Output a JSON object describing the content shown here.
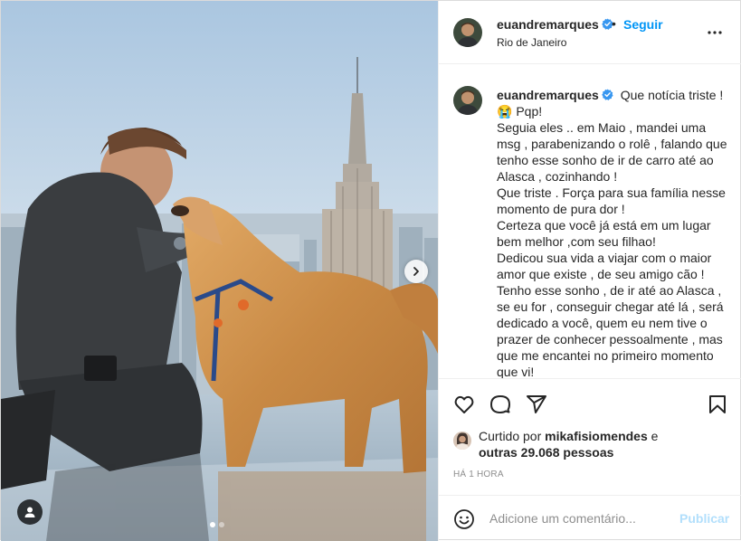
{
  "post": {
    "username": "euandremarques",
    "follow_label": "Seguir",
    "bullet": "•",
    "location": "Rio de Janeiro"
  },
  "caption": {
    "username": "euandremarques",
    "lines": [
      "Que notícia triste !",
      "😭 Pqp!",
      "Seguia eles .. em Maio , mandei uma msg , parabenizando o rolê , falando que tenho esse sonho de ir de carro até ao Alasca , cozinhando !",
      "Que triste . Força para sua família nesse momento de pura dor !",
      "Certeza que você já está em um lugar bem melhor ,com seu filhao!",
      "Dedicou sua vida a viajar com o maior amor que existe , de seu amigo cão !",
      "Tenho esse sonho , de ir até ao Alasca , se eu for , conseguir chegar até lá , será dedicado a você, quem eu nem tive o prazer de conhecer pessoalmente , mas que me encantei no primeiro momento que vi!"
    ]
  },
  "likes": {
    "prefix": "Curtido por",
    "liker": "mikafisiomendes",
    "connector": "e",
    "others": "outras 29.068 pessoas"
  },
  "timestamp": "HÁ 1 HORA",
  "comment": {
    "placeholder": "Adicione um comentário...",
    "publish_label": "Publicar"
  },
  "carousel": {
    "current_index": 1,
    "total": 2
  },
  "icons": {
    "verified": "verified-badge-icon",
    "more": "more-options-icon",
    "like": "heart-icon",
    "comment": "comment-icon",
    "share": "paper-plane-icon",
    "save": "bookmark-icon",
    "emoji": "emoji-icon",
    "next": "chevron-right-icon",
    "tag": "user-tag-icon"
  },
  "colors": {
    "accent": "#0095f6",
    "publish_disabled": "#b2dffc",
    "muted": "#8e8e8e",
    "border": "#dbdbdb"
  }
}
